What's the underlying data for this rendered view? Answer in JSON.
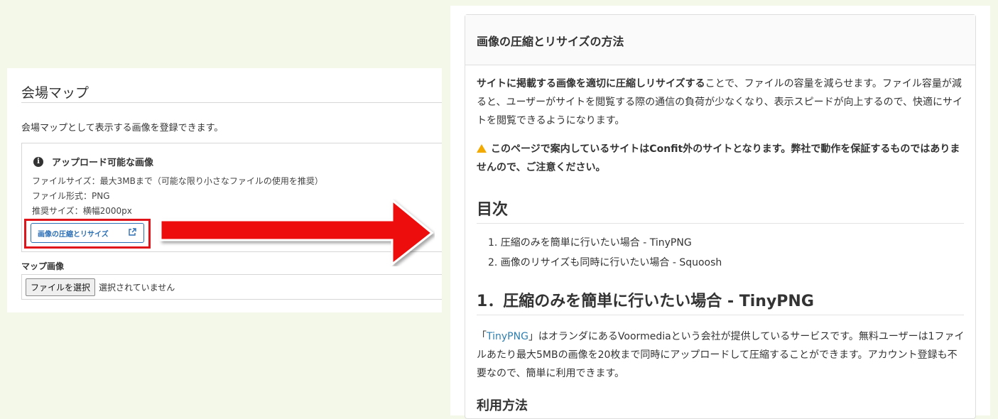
{
  "left": {
    "title": "会場マップ",
    "description": "会場マップとして表示する画像を登録できます。",
    "notice": {
      "icon": "info-icon",
      "title": "アップロード可能な画像",
      "lines": [
        "ファイルサイズ：最大3MBまで（可能な限り小さなファイルの使用を推奨）",
        "ファイル形式：PNG",
        "推奨サイズ：横幅2000px"
      ],
      "button_label": "画像の圧縮とリサイズ",
      "button_icon": "external-link-icon"
    },
    "map_label": "マップ画像",
    "file_button": "ファイルを選択",
    "file_status": "選択されていません"
  },
  "colors": {
    "highlight": "#e0141b",
    "link": "#2c6fb5",
    "background": "#f3f8e8"
  },
  "right": {
    "card_title": "画像の圧縮とリサイズの方法",
    "intro_bold": "サイトに掲載する画像を適切に圧縮しリサイズする",
    "intro_rest": "ことで、ファイルの容量を減らせます。ファイル容量が減ると、ユーザーがサイトを閲覧する際の通信の負荷が少なくなり、表示スピードが向上するので、快適にサイトを閲覧できるようになります。",
    "warning": "このページで案内しているサイトはConfit外のサイトとなります。弊社で動作を保証するものではありませんので、ご注意ください。",
    "toc_title": "目次",
    "toc": [
      "1. 圧縮のみを簡単に行いたい場合 - TinyPNG",
      "2. 画像のリサイズも同時に行いたい場合 - Squoosh"
    ],
    "section1_title": "1．圧縮のみを簡単に行いたい場合 - TinyPNG",
    "section1_open": "「",
    "section1_link": "TinyPNG",
    "section1_rest": "」はオランダにあるVoormediaという会社が提供しているサービスです。無料ユーザーは1ファイルあたり最大5MBの画像を20枚まで同時にアップロードして圧縮することができます。アカウント登録も不要なので、簡単に利用できます。",
    "usage_title": "利用方法"
  }
}
